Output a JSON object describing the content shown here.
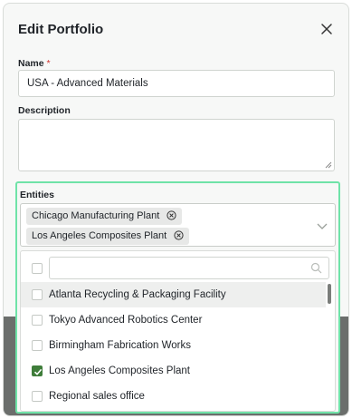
{
  "dialog": {
    "title": "Edit Portfolio"
  },
  "name_field": {
    "label": "Name",
    "required_mark": "*",
    "value": "USA - Advanced Materials"
  },
  "description_field": {
    "label": "Description",
    "value": ""
  },
  "entities_field": {
    "label": "Entities",
    "selected": [
      "Chicago Manufacturing Plant",
      "Los Angeles Composites Plant"
    ],
    "search_value": "",
    "options": [
      {
        "label": "Atlanta Recycling & Packaging Facility",
        "checked": false
      },
      {
        "label": "Tokyo Advanced Robotics Center",
        "checked": false
      },
      {
        "label": "Birmingham Fabrication Works",
        "checked": false
      },
      {
        "label": "Los Angeles Composites Plant",
        "checked": true
      },
      {
        "label": "Regional sales office",
        "checked": false
      }
    ]
  },
  "colors": {
    "accent_highlight": "#6fe3a8",
    "checkbox_checked": "#3f7d3a",
    "required": "#d0312d"
  }
}
